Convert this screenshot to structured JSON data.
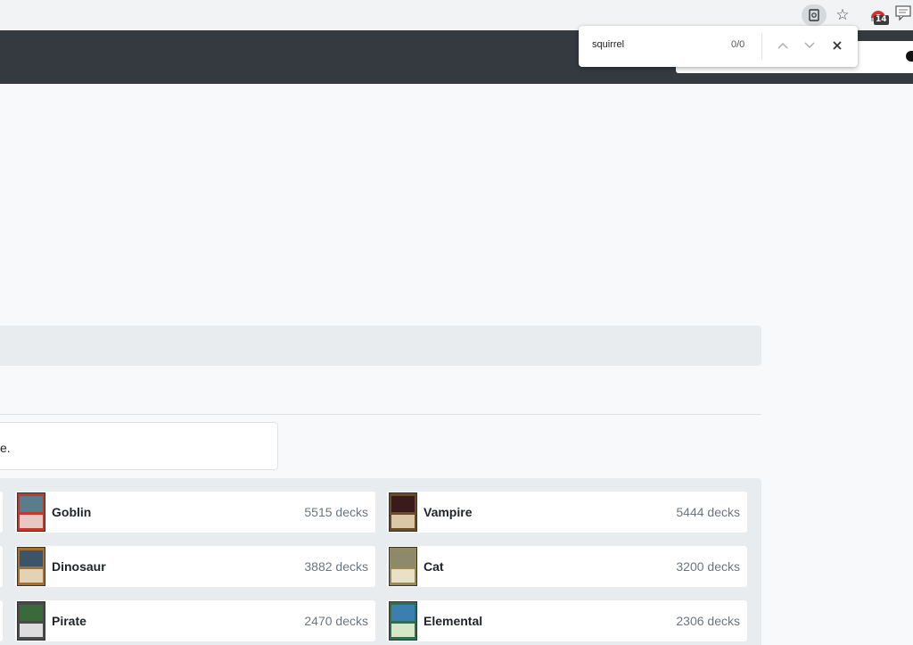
{
  "browser": {
    "find_query": "squirrel",
    "find_count": "0/0",
    "extension_badge": "14"
  },
  "content": {
    "notice_text": "e."
  },
  "tribes": [
    {
      "name": "Goblin",
      "decks": "5515 decks",
      "colors": {
        "frame": "#c0392b",
        "art": "#5b7c8a",
        "text": "#e8c8c0"
      }
    },
    {
      "name": "Vampire",
      "decks": "5444 decks",
      "colors": {
        "frame": "#6b4a2a",
        "art": "#3a1a1a",
        "text": "#d9c7a5"
      }
    },
    {
      "name": "Dinosaur",
      "decks": "3882 decks",
      "colors": {
        "frame": "#a5702f",
        "art": "#3c5368",
        "text": "#e3d2b3"
      }
    },
    {
      "name": "Cat",
      "decks": "3200 decks",
      "colors": {
        "frame": "#9a8a5a",
        "art": "#8c8a6a",
        "text": "#e9e1c6"
      }
    },
    {
      "name": "Pirate",
      "decks": "2470 decks",
      "colors": {
        "frame": "#4a4a4a",
        "art": "#3a6a3a",
        "text": "#dddddd"
      }
    },
    {
      "name": "Elemental",
      "decks": "2306 decks",
      "colors": {
        "frame": "#2f6f4f",
        "art": "#3a7fb0",
        "text": "#d8e6c8"
      }
    }
  ]
}
